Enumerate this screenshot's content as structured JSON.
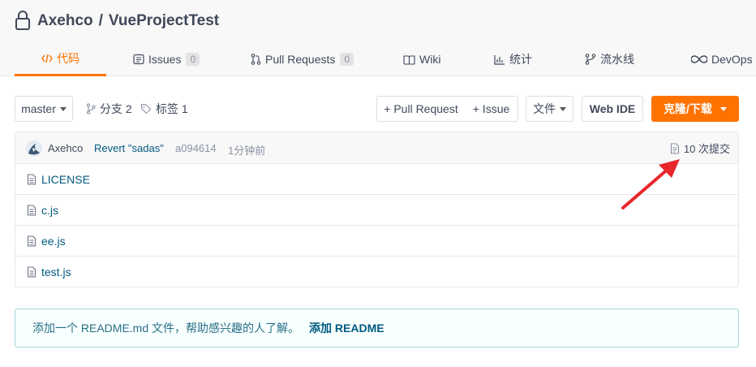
{
  "header": {
    "owner": "Axehco",
    "separator": "/",
    "repo": "VueProjectTest"
  },
  "tabs": [
    {
      "label": "代码",
      "icon": "code-icon",
      "active": true
    },
    {
      "label": "Issues",
      "icon": "issues-icon",
      "count": "0"
    },
    {
      "label": "Pull Requests",
      "icon": "pull-request-icon",
      "count": "0"
    },
    {
      "label": "Wiki",
      "icon": "wiki-book-icon"
    },
    {
      "label": "统计",
      "icon": "stats-bar-icon"
    },
    {
      "label": "流水线",
      "icon": "pipeline-icon"
    },
    {
      "label": "DevOps",
      "icon": "infinity-icon"
    }
  ],
  "toolbar": {
    "branch": "master",
    "branches": "分支 2",
    "tags": "标签 1",
    "pull_request": "+ Pull Request",
    "issue": "+ Issue",
    "file": "文件",
    "web_ide": "Web IDE",
    "clone": "克隆/下载"
  },
  "commit": {
    "author": "Axehco",
    "message": "Revert \"sadas\"",
    "hash": "a094614",
    "time": "1分钟前",
    "count": "10 次提交"
  },
  "files": [
    {
      "name": "LICENSE"
    },
    {
      "name": "c.js"
    },
    {
      "name": "ee.js"
    },
    {
      "name": "test.js"
    }
  ],
  "readme": {
    "text": "添加一个 README.md 文件，帮助感兴趣的人了解。",
    "link": "添加 README"
  },
  "colors": {
    "accent": "#fe7300",
    "link": "#005980",
    "arrow": "#e8262b"
  }
}
